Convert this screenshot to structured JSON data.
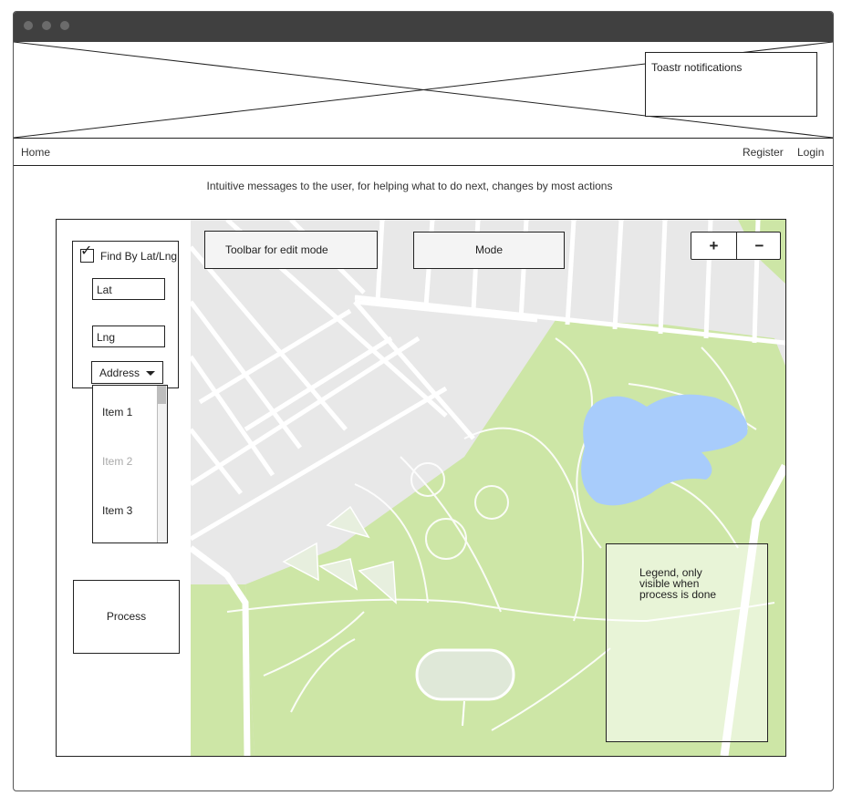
{
  "header": {
    "toastr": "Toastr notifications"
  },
  "nav": {
    "home": "Home",
    "register": "Register",
    "login": "Login"
  },
  "message": "Intuitive messages to the user, for helping what to do next, changes by most actions",
  "sidebar": {
    "find_label": "Find By Lat/Lng",
    "lat": "Lat",
    "lng": "Lng",
    "address": "Address",
    "dropdown_items": [
      "Item 1",
      "Item 2",
      "Item 3"
    ],
    "process": "Process"
  },
  "map": {
    "toolbar": "Toolbar for edit mode",
    "mode": "Mode",
    "zoom_in": "+",
    "zoom_out": "−",
    "legend": "Legend, only visible when process is done"
  },
  "colors": {
    "park": "#cde6a6",
    "water": "#a8ccfb",
    "urban": "#e8e8e8"
  }
}
